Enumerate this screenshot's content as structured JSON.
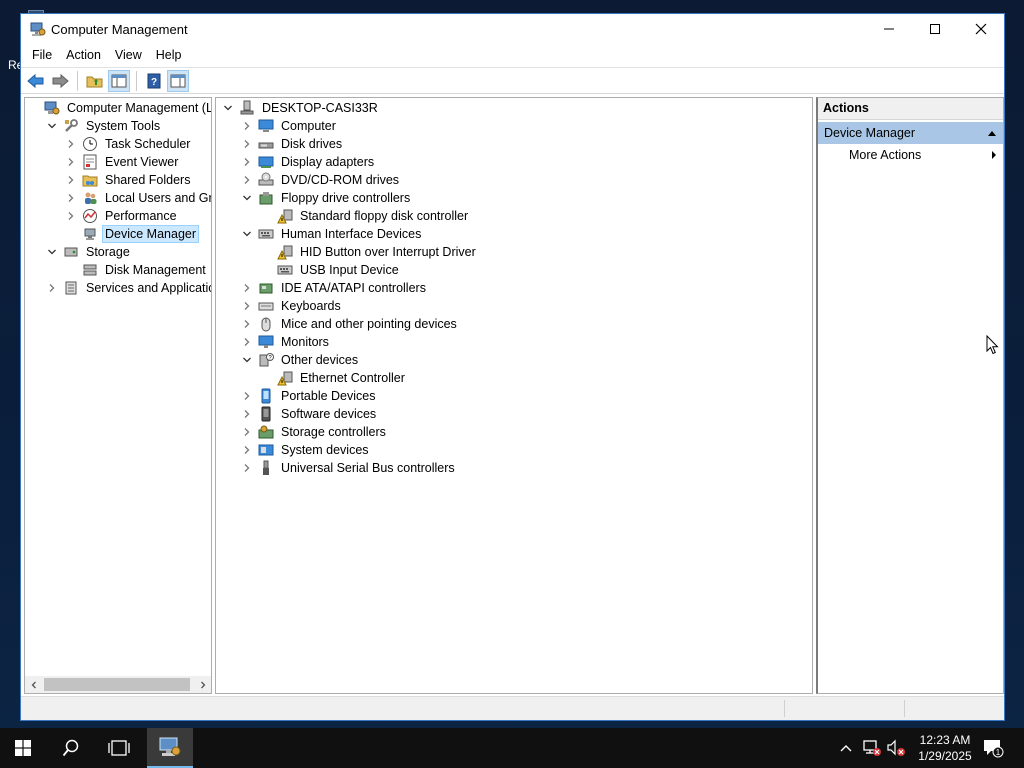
{
  "desktop": {
    "partial_label": "Re"
  },
  "window": {
    "title": "Computer Management",
    "menu": [
      "File",
      "Action",
      "View",
      "Help"
    ],
    "toolbar_icons": [
      "back-arrow-icon",
      "forward-arrow-icon",
      "up-folder-icon",
      "show-hide-console-tree-icon",
      "help-icon",
      "show-hide-action-pane-icon"
    ]
  },
  "left_tree": [
    {
      "label": "Computer Management (Local",
      "icon": "computer-management-icon",
      "level": 0,
      "toggle": "none"
    },
    {
      "label": "System Tools",
      "icon": "tools-icon",
      "level": 1,
      "toggle": "expanded"
    },
    {
      "label": "Task Scheduler",
      "icon": "clock-icon",
      "level": 2,
      "toggle": "collapsed"
    },
    {
      "label": "Event Viewer",
      "icon": "event-viewer-icon",
      "level": 2,
      "toggle": "collapsed"
    },
    {
      "label": "Shared Folders",
      "icon": "shared-folders-icon",
      "level": 2,
      "toggle": "collapsed"
    },
    {
      "label": "Local Users and Groups",
      "icon": "users-icon",
      "level": 2,
      "toggle": "collapsed"
    },
    {
      "label": "Performance",
      "icon": "performance-icon",
      "level": 2,
      "toggle": "collapsed"
    },
    {
      "label": "Device Manager",
      "icon": "device-manager-icon",
      "level": 2,
      "toggle": "none",
      "selected": true
    },
    {
      "label": "Storage",
      "icon": "storage-icon",
      "level": 1,
      "toggle": "expanded"
    },
    {
      "label": "Disk Management",
      "icon": "disk-management-icon",
      "level": 2,
      "toggle": "none"
    },
    {
      "label": "Services and Applications",
      "icon": "services-icon",
      "level": 1,
      "toggle": "collapsed"
    }
  ],
  "device_tree": [
    {
      "label": "DESKTOP-CASI33R",
      "icon": "computer-root-icon",
      "level": 0,
      "toggle": "expanded"
    },
    {
      "label": "Computer",
      "icon": "computer-icon",
      "level": 1,
      "toggle": "collapsed"
    },
    {
      "label": "Disk drives",
      "icon": "disk-drive-icon",
      "level": 1,
      "toggle": "collapsed"
    },
    {
      "label": "Display adapters",
      "icon": "display-adapter-icon",
      "level": 1,
      "toggle": "collapsed"
    },
    {
      "label": "DVD/CD-ROM drives",
      "icon": "dvd-drive-icon",
      "level": 1,
      "toggle": "collapsed"
    },
    {
      "label": "Floppy drive controllers",
      "icon": "floppy-controller-icon",
      "level": 1,
      "toggle": "expanded"
    },
    {
      "label": "Standard floppy disk controller",
      "icon": "warning-device-icon",
      "level": 2,
      "toggle": "none"
    },
    {
      "label": "Human Interface Devices",
      "icon": "hid-icon",
      "level": 1,
      "toggle": "expanded"
    },
    {
      "label": "HID Button over Interrupt Driver",
      "icon": "warning-device-icon",
      "level": 2,
      "toggle": "none"
    },
    {
      "label": "USB Input Device",
      "icon": "hid-icon",
      "level": 2,
      "toggle": "none"
    },
    {
      "label": "IDE ATA/ATAPI controllers",
      "icon": "ide-controller-icon",
      "level": 1,
      "toggle": "collapsed"
    },
    {
      "label": "Keyboards",
      "icon": "keyboard-icon",
      "level": 1,
      "toggle": "collapsed"
    },
    {
      "label": "Mice and other pointing devices",
      "icon": "mouse-icon",
      "level": 1,
      "toggle": "collapsed"
    },
    {
      "label": "Monitors",
      "icon": "monitor-icon",
      "level": 1,
      "toggle": "collapsed"
    },
    {
      "label": "Other devices",
      "icon": "unknown-device-icon",
      "level": 1,
      "toggle": "expanded"
    },
    {
      "label": "Ethernet Controller",
      "icon": "warning-device-icon",
      "level": 2,
      "toggle": "none"
    },
    {
      "label": "Portable Devices",
      "icon": "portable-device-icon",
      "level": 1,
      "toggle": "collapsed"
    },
    {
      "label": "Software devices",
      "icon": "software-device-icon",
      "level": 1,
      "toggle": "collapsed"
    },
    {
      "label": "Storage controllers",
      "icon": "storage-controller-icon",
      "level": 1,
      "toggle": "collapsed"
    },
    {
      "label": "System devices",
      "icon": "system-device-icon",
      "level": 1,
      "toggle": "collapsed"
    },
    {
      "label": "Universal Serial Bus controllers",
      "icon": "usb-icon",
      "level": 1,
      "toggle": "collapsed"
    }
  ],
  "actions_pane": {
    "header": "Actions",
    "section": "Device Manager",
    "items": [
      "More Actions"
    ]
  },
  "taskbar": {
    "time": "12:23 AM",
    "date": "1/29/2025",
    "notification_count": "1"
  },
  "colors": {
    "selection": "#cce8ff",
    "actions_section": "#a9c6e6",
    "window_border": "#3a78c3",
    "taskbar": "#101010"
  }
}
